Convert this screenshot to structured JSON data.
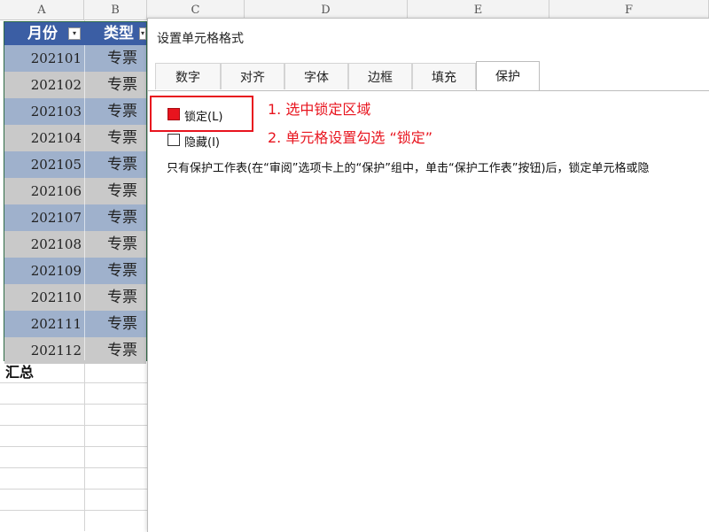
{
  "columns": [
    "A",
    "B",
    "C",
    "D",
    "E",
    "F"
  ],
  "table": {
    "headers": {
      "month": "月份",
      "type": "类型"
    },
    "filter_icon": "dropdown-arrow",
    "rows": [
      {
        "month": "202101",
        "type": "专票"
      },
      {
        "month": "202102",
        "type": "专票"
      },
      {
        "month": "202103",
        "type": "专票"
      },
      {
        "month": "202104",
        "type": "专票"
      },
      {
        "month": "202105",
        "type": "专票"
      },
      {
        "month": "202106",
        "type": "专票"
      },
      {
        "month": "202107",
        "type": "专票"
      },
      {
        "month": "202108",
        "type": "专票"
      },
      {
        "month": "202109",
        "type": "专票"
      },
      {
        "month": "202110",
        "type": "专票"
      },
      {
        "month": "202111",
        "type": "专票"
      },
      {
        "month": "202112",
        "type": "专票"
      }
    ],
    "summary_label": "汇总",
    "colors": {
      "header": "#3b5ea4",
      "row_dark": "#9fb1cc",
      "row_light": "#c9c9c9",
      "border": "#2f6b46"
    }
  },
  "dialog": {
    "title": "设置单元格格式",
    "tabs": [
      "数字",
      "对齐",
      "字体",
      "边框",
      "填充",
      "保护"
    ],
    "active_tab": "保护",
    "locked": {
      "label": "锁定(L)",
      "checked": true
    },
    "hidden": {
      "label": "隐藏(I)",
      "checked": false
    },
    "note": "只有保护工作表(在“审阅”选项卡上的“保护”组中，单击“保护工作表”按钮)后，锁定单元格或隐"
  },
  "annotations": {
    "step1": "1. 选中锁定区域",
    "step2": "2. 单元格设置勾选 “锁定”",
    "color": "#e8141e"
  }
}
